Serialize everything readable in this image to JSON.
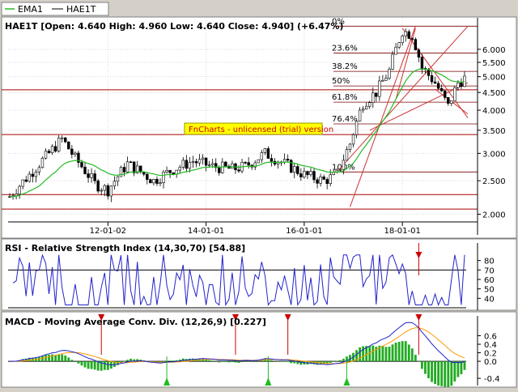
{
  "legend": [
    {
      "name": "EMA1",
      "color": "#22bb22"
    },
    {
      "name": "HAE1T",
      "color": "#000000"
    }
  ],
  "watermark": "FnCharts - unlicensed (trial) version",
  "colors": {
    "ema": "#22bb22",
    "candle_up": "#ffffff",
    "candle_down": "#000000",
    "rsi_line": "#2222cc",
    "macd_line": "#2222cc",
    "signal_line": "#ff9900",
    "histogram_pos": "#22aa22",
    "histogram_neg": "#22aa22",
    "fib_line": "#7a0000",
    "sr_line": "#aa0000",
    "trend_line": "#cc3333",
    "signal_up": "#22bb22",
    "signal_down": "#cc0000"
  },
  "chart_data": [
    {
      "type": "candlestick",
      "title": "HAE1T [Open: 4.640  High: 4.960  Low: 4.640  Close: 4.940] (+6.47%)",
      "y_scale": "log",
      "ylim": [
        1.9,
        7.4
      ],
      "y_ticks": [
        2.0,
        2.5,
        3.0,
        3.5,
        4.0,
        4.5,
        5.0,
        5.5,
        6.0
      ],
      "y_tick_labels": [
        "2.000",
        "2.500",
        "3.000",
        "3.500",
        "4.000",
        "4.500",
        "5.000",
        "5.500",
        "6.000"
      ],
      "x_ticks": [
        {
          "index": 30,
          "label": "12-01-02"
        },
        {
          "index": 60,
          "label": "14-01-01"
        },
        {
          "index": 90,
          "label": "16-01-01"
        },
        {
          "index": 120,
          "label": "18-01-01"
        }
      ],
      "n_bars": 140,
      "fibonacci": [
        {
          "label": "0%",
          "value": 7.0
        },
        {
          "label": "23.6%",
          "value": 5.85
        },
        {
          "label": "38.2%",
          "value": 5.18
        },
        {
          "label": "50%",
          "value": 4.7
        },
        {
          "label": "61.8%",
          "value": 4.22
        },
        {
          "label": "76.4%",
          "value": 3.65
        },
        {
          "label": "100%",
          "value": 2.65
        }
      ],
      "support_resistance": [
        2.07,
        2.28,
        3.4,
        4.58
      ],
      "last_close": 4.94
    },
    {
      "type": "line",
      "title": "RSI - Relative Strength Index (14,30,70) [54.88]",
      "ylim": [
        30,
        90
      ],
      "y_ticks": [
        40,
        50,
        60,
        70,
        80
      ],
      "levels": [
        30,
        70
      ],
      "last_value": 54.88
    },
    {
      "type": "line",
      "title": "MACD - Moving Average Conv. Div. (12,26,9) [0.227]",
      "ylim": [
        -0.55,
        0.8
      ],
      "y_ticks": [
        -0.4,
        0.0,
        0.2,
        0.4,
        0.6
      ],
      "y_tick_labels": [
        "-0.4",
        "0.0",
        "0.2",
        "0.4",
        "0.6"
      ],
      "last_value": 0.227,
      "buy_signal_bars": [
        48,
        79,
        103
      ],
      "sell_signal_bars": [
        28,
        69,
        85,
        125
      ]
    }
  ]
}
